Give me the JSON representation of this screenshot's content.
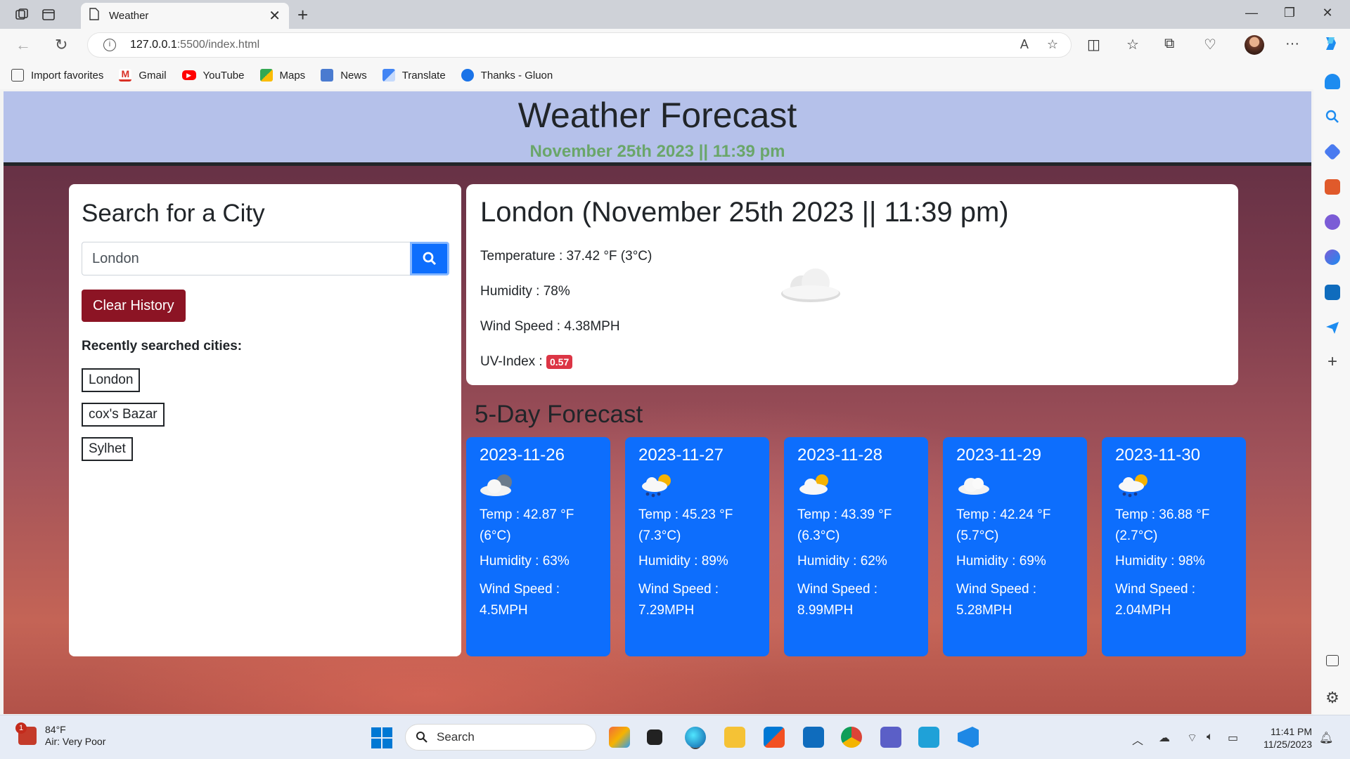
{
  "browser": {
    "tab_title": "Weather",
    "url_host": "127.0.0.1",
    "url_path": ":5500/index.html",
    "favorites": [
      {
        "label": "Import favorites",
        "icon": "import-icon",
        "color": "#444444"
      },
      {
        "label": "Gmail",
        "icon": "gmail-icon",
        "color": "#d93025"
      },
      {
        "label": "YouTube",
        "icon": "youtube-icon",
        "color": "#ff0000"
      },
      {
        "label": "Maps",
        "icon": "maps-icon",
        "color": "#34a853"
      },
      {
        "label": "News",
        "icon": "news-icon",
        "color": "#4a7bd0"
      },
      {
        "label": "Translate",
        "icon": "translate-icon",
        "color": "#4285f4"
      },
      {
        "label": "Thanks - Gluon",
        "icon": "gluon-icon",
        "color": "#1a73e8"
      }
    ]
  },
  "header": {
    "title": "Weather Forecast",
    "datetime": "November 25th 2023 || 11:39 pm"
  },
  "search": {
    "heading": "Search for a City",
    "input_value": "London",
    "clear_label": "Clear History",
    "recent_label": "Recently searched cities:",
    "history": [
      "London",
      "cox's Bazar",
      "Sylhet"
    ]
  },
  "current": {
    "title": "London (November 25th 2023 || 11:39 pm)",
    "temperature": "Temperature : 37.42 °F (3°C)",
    "humidity": "Humidity : 78%",
    "wind": "Wind Speed : 4.38MPH",
    "uv_label": "UV-Index :",
    "uv_value": "0.57",
    "icon": "cloud-icon"
  },
  "forecast": {
    "title": "5-Day Forecast",
    "days": [
      {
        "date": "2023-11-26",
        "temp": "Temp : 42.87 °F (6°C)",
        "humidity": "Humidity : 63%",
        "wind": "Wind Speed : 4.5MPH",
        "icon": "cloud-icon"
      },
      {
        "date": "2023-11-27",
        "temp": "Temp : 45.23 °F (7.3°C)",
        "humidity": "Humidity : 89%",
        "wind": "Wind Speed : 7.29MPH",
        "icon": "sun-rain-icon"
      },
      {
        "date": "2023-11-28",
        "temp": "Temp : 43.39 °F (6.3°C)",
        "humidity": "Humidity : 62%",
        "wind": "Wind Speed : 8.99MPH",
        "icon": "sun-cloud-icon"
      },
      {
        "date": "2023-11-29",
        "temp": "Temp : 42.24 °F (5.7°C)",
        "humidity": "Humidity : 69%",
        "wind": "Wind Speed : 5.28MPH",
        "icon": "cloud-icon"
      },
      {
        "date": "2023-11-30",
        "temp": "Temp : 36.88 °F (2.7°C)",
        "humidity": "Humidity : 98%",
        "wind": "Wind Speed : 2.04MPH",
        "icon": "sun-rain-icon"
      }
    ]
  },
  "taskbar": {
    "weather_badge": "1",
    "weather_temp": "84°F",
    "weather_air": "Air: Very Poor",
    "search_label": "Search",
    "time": "11:41 PM",
    "date": "11/25/2023"
  },
  "colors": {
    "header_bg": "#b5c1ea",
    "date_green": "#6aa66a",
    "card_blue": "#0d6efd",
    "clear_red": "#8c1424",
    "uv_red": "#dc3545"
  }
}
